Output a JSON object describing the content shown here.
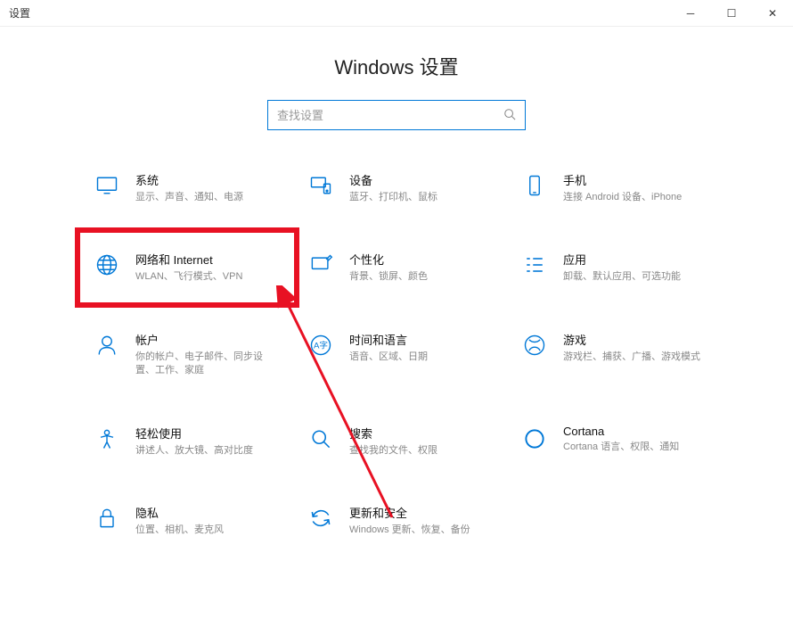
{
  "window": {
    "title": "设置",
    "min": "─",
    "max": "☐",
    "close": "✕"
  },
  "header": {
    "title": "Windows 设置"
  },
  "search": {
    "placeholder": "查找设置"
  },
  "tiles": [
    {
      "id": "system",
      "title": "系统",
      "desc": "显示、声音、通知、电源"
    },
    {
      "id": "devices",
      "title": "设备",
      "desc": "蓝牙、打印机、鼠标"
    },
    {
      "id": "phone",
      "title": "手机",
      "desc": "连接 Android 设备、iPhone"
    },
    {
      "id": "network",
      "title": "网络和 Internet",
      "desc": "WLAN、飞行模式、VPN"
    },
    {
      "id": "personalization",
      "title": "个性化",
      "desc": "背景、锁屏、颜色"
    },
    {
      "id": "apps",
      "title": "应用",
      "desc": "卸载、默认应用、可选功能"
    },
    {
      "id": "accounts",
      "title": "帐户",
      "desc": "你的帐户、电子邮件、同步设置、工作、家庭"
    },
    {
      "id": "time",
      "title": "时间和语言",
      "desc": "语音、区域、日期"
    },
    {
      "id": "gaming",
      "title": "游戏",
      "desc": "游戏栏、捕获、广播、游戏模式"
    },
    {
      "id": "ease",
      "title": "轻松使用",
      "desc": "讲述人、放大镜、高对比度"
    },
    {
      "id": "search-tile",
      "title": "搜索",
      "desc": "查找我的文件、权限"
    },
    {
      "id": "cortana",
      "title": "Cortana",
      "desc": "Cortana 语言、权限、通知"
    },
    {
      "id": "privacy",
      "title": "隐私",
      "desc": "位置、相机、麦克风"
    },
    {
      "id": "update",
      "title": "更新和安全",
      "desc": "Windows 更新、恢复、备份"
    }
  ]
}
